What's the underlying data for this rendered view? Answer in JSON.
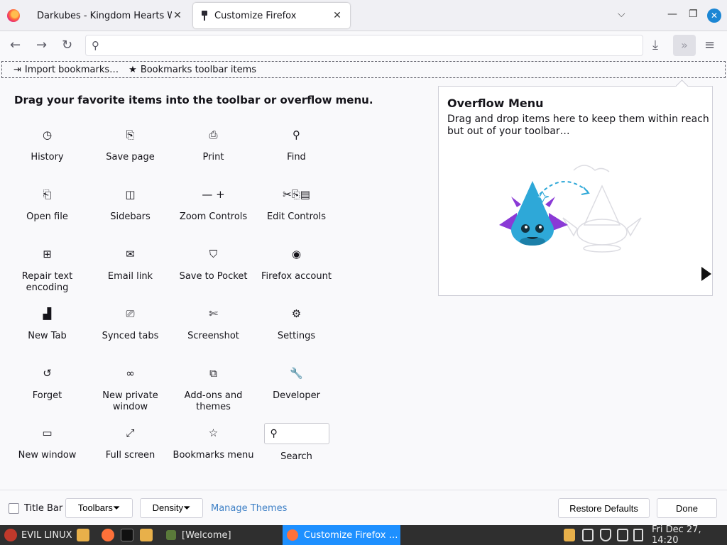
{
  "tabs": [
    {
      "label": "Darkubes - Kingdom Hearts Wik",
      "close": "✕"
    },
    {
      "label": "Customize Firefox",
      "close": "✕"
    }
  ],
  "window_controls": {
    "list": "⌵",
    "minimize": "—",
    "maximize": "❐",
    "close": "✕"
  },
  "nav": {
    "back": "←",
    "forward": "→",
    "reload": "↻",
    "search_icon": "⚲",
    "url_value": "",
    "downloads": "⤓",
    "overflow": "»",
    "menu": "≡"
  },
  "bookmarks": [
    {
      "icon": "import-icon",
      "glyph": "⇥",
      "label": "Import bookmarks…"
    },
    {
      "icon": "star-icon",
      "glyph": "★",
      "label": "Bookmarks toolbar items"
    }
  ],
  "heading": "Drag your favorite items into the toolbar or overflow menu.",
  "palette": [
    {
      "label": "History",
      "icon": "clock-icon",
      "glyph": "◷"
    },
    {
      "label": "Save page",
      "icon": "save-page-icon",
      "glyph": "⎘"
    },
    {
      "label": "Print",
      "icon": "printer-icon",
      "glyph": "⎙"
    },
    {
      "label": "Find",
      "icon": "search-icon",
      "glyph": "⚲"
    },
    {
      "label": "Open file",
      "icon": "open-file-icon",
      "glyph": "⎗"
    },
    {
      "label": "Sidebars",
      "icon": "sidebar-icon",
      "glyph": "◫"
    },
    {
      "label": "Zoom Controls",
      "icon": "zoom-icon",
      "glyph": "— +"
    },
    {
      "label": "Edit Controls",
      "icon": "edit-icon",
      "glyph": "✂⎘▤"
    },
    {
      "label": "Repair text encoding",
      "icon": "encoding-icon",
      "glyph": "⊞"
    },
    {
      "label": "Email link",
      "icon": "mail-icon",
      "glyph": "✉"
    },
    {
      "label": "Save to Pocket",
      "icon": "pocket-icon",
      "glyph": "⛉"
    },
    {
      "label": "Firefox account",
      "icon": "account-icon",
      "glyph": "◉"
    },
    {
      "label": "New Tab",
      "icon": "new-tab-icon",
      "glyph": "▟"
    },
    {
      "label": "Synced tabs",
      "icon": "synced-tabs-icon",
      "glyph": "⎚"
    },
    {
      "label": "Screenshot",
      "icon": "screenshot-icon",
      "glyph": "✄"
    },
    {
      "label": "Settings",
      "icon": "gear-icon",
      "glyph": "⚙"
    },
    {
      "label": "Forget",
      "icon": "forget-icon",
      "glyph": "↺"
    },
    {
      "label": "New private window",
      "icon": "mask-icon",
      "glyph": "∞"
    },
    {
      "label": "Add-ons and themes",
      "icon": "puzzle-icon",
      "glyph": "⧉"
    },
    {
      "label": "Developer",
      "icon": "wrench-icon",
      "glyph": "🔧"
    },
    {
      "label": "New window",
      "icon": "window-icon",
      "glyph": "▭"
    },
    {
      "label": "Full screen",
      "icon": "fullscreen-icon",
      "glyph": "⤢"
    },
    {
      "label": "Bookmarks menu",
      "icon": "star-icon",
      "glyph": "☆"
    },
    {
      "label": "Search",
      "icon": "search-field-icon",
      "glyph": "⚲"
    }
  ],
  "overflow_panel": {
    "title": "Overflow Menu",
    "description": "Drag and drop items here to keep them within reach but out of your toolbar…"
  },
  "footer": {
    "title_bar": "Title Bar",
    "toolbars": "Toolbars⏷",
    "density": "Density⏷",
    "manage_themes": "Manage Themes",
    "restore": "Restore Defaults",
    "done": "Done"
  },
  "taskbar": {
    "os_label": "EVIL LINUX",
    "welcome": "[Welcome]",
    "active_window": "Customize Firefox …",
    "clock": "Fri Dec 27, 14:20"
  },
  "colors": {
    "accent": "#1e90ff",
    "link": "#3e80c6",
    "close_button": "#1b86d4",
    "dragon": "#2ea8d8",
    "wings": "#8a3ad6"
  }
}
